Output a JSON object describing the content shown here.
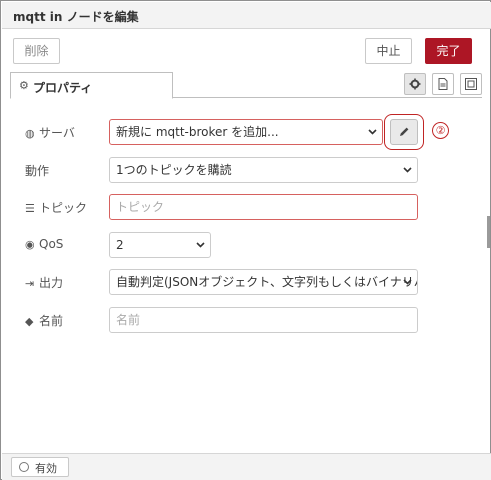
{
  "window": {
    "title": "mqtt in ノードを編集"
  },
  "toolbar": {
    "delete_label": "削除",
    "cancel_label": "中止",
    "done_label": "完了"
  },
  "tabs": {
    "properties_label": "プロパティ"
  },
  "form": {
    "server": {
      "label": "サーバ",
      "value": "新規に mqtt-broker を追加..."
    },
    "action": {
      "label": "動作",
      "value": "1つのトピックを購読"
    },
    "topic": {
      "label": "トピック",
      "value": "",
      "placeholder": "トピック"
    },
    "qos": {
      "label": "QoS",
      "value": "2"
    },
    "output": {
      "label": "出力",
      "value": "自動判定(JSONオブジェクト、文字列もしくはバイナリバ"
    },
    "name": {
      "label": "名前",
      "value": "",
      "placeholder": "名前"
    }
  },
  "annotation": {
    "marker": "②"
  },
  "footer": {
    "enabled_label": "有効"
  },
  "colors": {
    "accent": "#ad1625",
    "error_border": "#d6615f",
    "annotation": "#c02424"
  },
  "icons": [
    "cog-icon",
    "file-icon",
    "layout-icon",
    "globe-icon",
    "list-icon",
    "radio-icon",
    "sign-out-icon",
    "tag-icon",
    "pencil-icon",
    "chevron-down-icon",
    "circle-icon"
  ]
}
